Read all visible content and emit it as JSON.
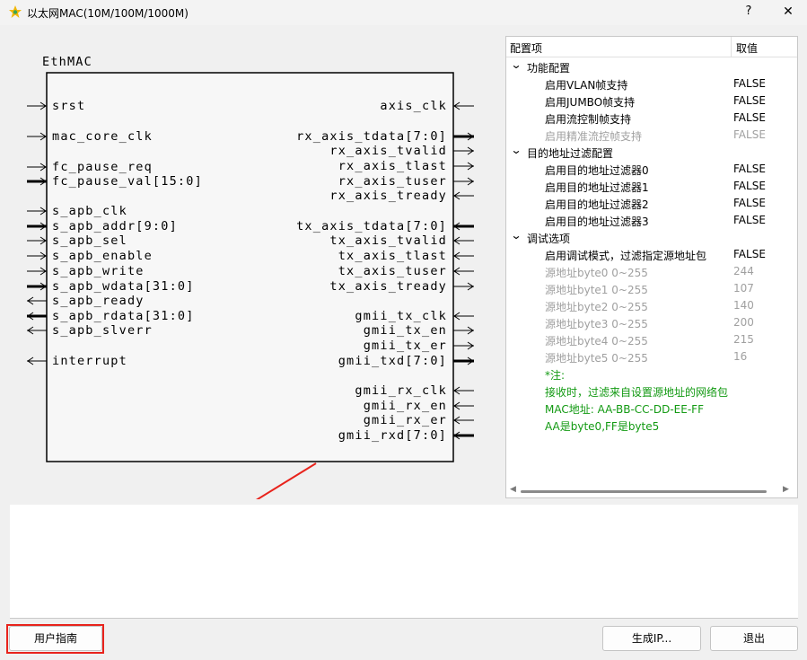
{
  "window": {
    "title": "以太网MAC(10M/100M/1000M)",
    "help": "?",
    "close": "✕"
  },
  "diagram": {
    "block_name": "EthMAC",
    "left_ports": [
      {
        "label": "srst",
        "dir": "in",
        "bus": false
      },
      {
        "label": "mac_core_clk",
        "dir": "in",
        "bus": false
      },
      {
        "label": "fc_pause_req",
        "dir": "in",
        "bus": false
      },
      {
        "label": "fc_pause_val[15:0]",
        "dir": "in",
        "bus": true
      },
      {
        "label": "s_apb_clk",
        "dir": "in",
        "bus": false
      },
      {
        "label": "s_apb_addr[9:0]",
        "dir": "in",
        "bus": true
      },
      {
        "label": "s_apb_sel",
        "dir": "in",
        "bus": false
      },
      {
        "label": "s_apb_enable",
        "dir": "in",
        "bus": false
      },
      {
        "label": "s_apb_write",
        "dir": "in",
        "bus": false
      },
      {
        "label": "s_apb_wdata[31:0]",
        "dir": "in",
        "bus": true
      },
      {
        "label": "s_apb_ready",
        "dir": "out",
        "bus": false
      },
      {
        "label": "s_apb_rdata[31:0]",
        "dir": "out",
        "bus": true
      },
      {
        "label": "s_apb_slverr",
        "dir": "out",
        "bus": false
      },
      {
        "label": "interrupt",
        "dir": "out",
        "bus": false
      }
    ],
    "right_ports": [
      {
        "label": "axis_clk",
        "dir": "in",
        "bus": false
      },
      {
        "label": "rx_axis_tdata[7:0]",
        "dir": "out",
        "bus": true
      },
      {
        "label": "rx_axis_tvalid",
        "dir": "out",
        "bus": false
      },
      {
        "label": "rx_axis_tlast",
        "dir": "out",
        "bus": false
      },
      {
        "label": "rx_axis_tuser",
        "dir": "out",
        "bus": false
      },
      {
        "label": "rx_axis_tready",
        "dir": "in",
        "bus": false
      },
      {
        "label": "tx_axis_tdata[7:0]",
        "dir": "in",
        "bus": true
      },
      {
        "label": "tx_axis_tvalid",
        "dir": "in",
        "bus": false
      },
      {
        "label": "tx_axis_tlast",
        "dir": "in",
        "bus": false
      },
      {
        "label": "tx_axis_tuser",
        "dir": "in",
        "bus": false
      },
      {
        "label": "tx_axis_tready",
        "dir": "out",
        "bus": false
      },
      {
        "label": "gmii_tx_clk",
        "dir": "in",
        "bus": false
      },
      {
        "label": "gmii_tx_en",
        "dir": "out",
        "bus": false
      },
      {
        "label": "gmii_tx_er",
        "dir": "out",
        "bus": false
      },
      {
        "label": "gmii_txd[7:0]",
        "dir": "out",
        "bus": true
      },
      {
        "label": "gmii_rx_clk",
        "dir": "in",
        "bus": false
      },
      {
        "label": "gmii_rx_en",
        "dir": "in",
        "bus": false
      },
      {
        "label": "gmii_rx_er",
        "dir": "in",
        "bus": false
      },
      {
        "label": "gmii_rxd[7:0]",
        "dir": "in",
        "bus": true
      }
    ]
  },
  "config": {
    "col_name": "配置项",
    "col_value": "取值",
    "groups": [
      {
        "label": "功能配置",
        "items": [
          {
            "name": "启用VLAN帧支持",
            "value": "FALSE",
            "disabled": false
          },
          {
            "name": "启用JUMBO帧支持",
            "value": "FALSE",
            "disabled": false
          },
          {
            "name": "启用流控制帧支持",
            "value": "FALSE",
            "disabled": false
          },
          {
            "name": "启用精准流控帧支持",
            "value": "FALSE",
            "disabled": true
          }
        ]
      },
      {
        "label": "目的地址过滤配置",
        "items": [
          {
            "name": "启用目的地址过滤器0",
            "value": "FALSE",
            "disabled": false
          },
          {
            "name": "启用目的地址过滤器1",
            "value": "FALSE",
            "disabled": false
          },
          {
            "name": "启用目的地址过滤器2",
            "value": "FALSE",
            "disabled": false
          },
          {
            "name": "启用目的地址过滤器3",
            "value": "FALSE",
            "disabled": false
          }
        ]
      },
      {
        "label": "调试选项",
        "items": [
          {
            "name": "启用调试模式，过滤指定源地址包",
            "value": "FALSE",
            "disabled": false
          },
          {
            "name": "源地址byte0 0~255",
            "value": "244",
            "disabled": true
          },
          {
            "name": "源地址byte1 0~255",
            "value": "107",
            "disabled": true
          },
          {
            "name": "源地址byte2 0~255",
            "value": "140",
            "disabled": true
          },
          {
            "name": "源地址byte3 0~255",
            "value": "200",
            "disabled": true
          },
          {
            "name": "源地址byte4 0~255",
            "value": "215",
            "disabled": true
          },
          {
            "name": "源地址byte5 0~255",
            "value": "16",
            "disabled": true
          }
        ]
      }
    ],
    "notes": [
      "*注:",
      "接收时，过滤来自设置源地址的网络包",
      "MAC地址: AA-BB-CC-DD-EE-FF",
      "AA是byte0,FF是byte5"
    ]
  },
  "buttons": {
    "guide": "用户指南",
    "generate": "生成IP...",
    "exit": "退出"
  },
  "colors": {
    "highlight": "#e8231c",
    "note": "#139a13",
    "disabled": "#a0a0a0"
  }
}
